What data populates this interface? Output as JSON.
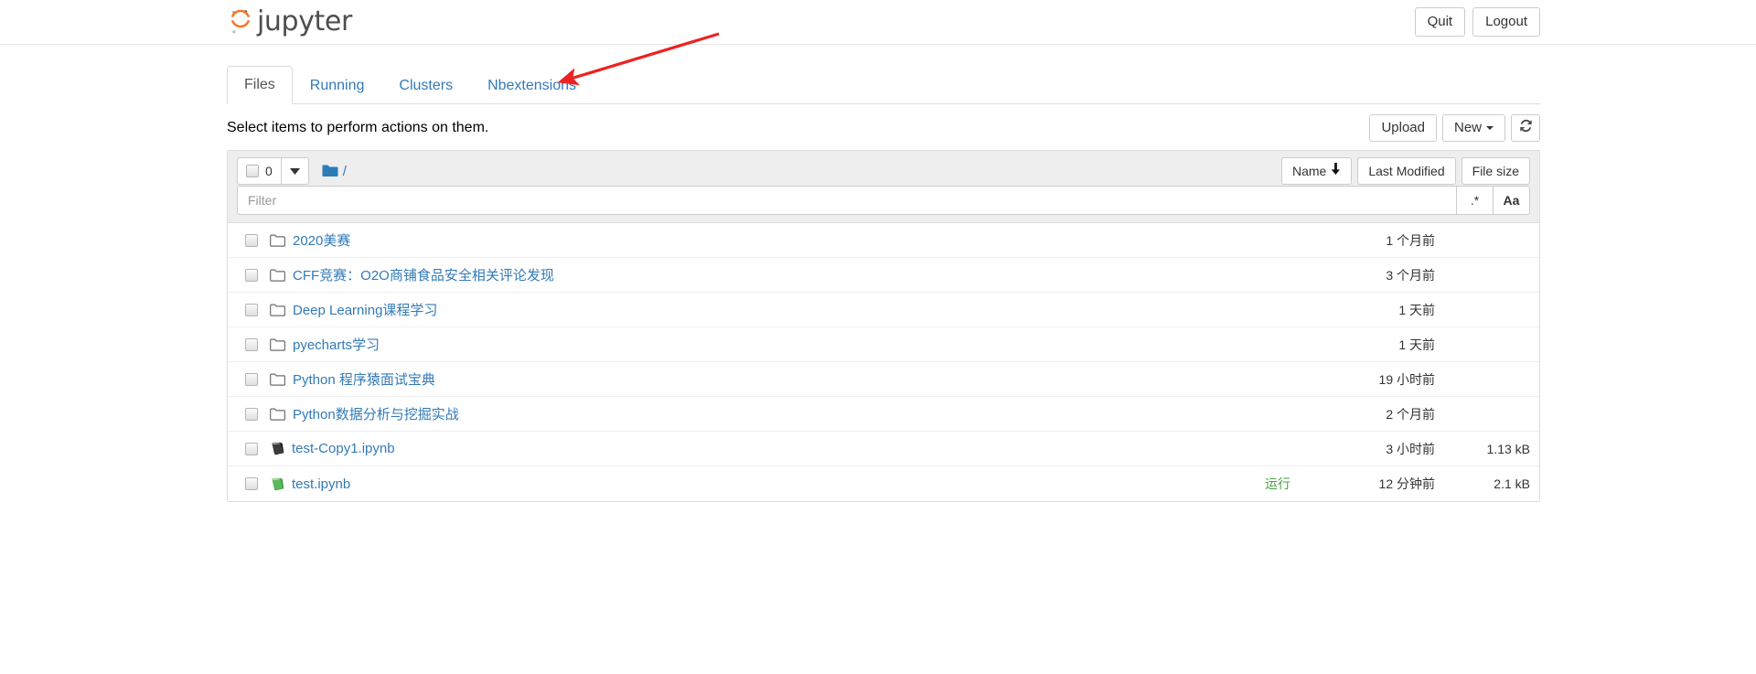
{
  "header": {
    "brand": "jupyter",
    "logo_icon": "jupyter-logo-icon",
    "quit_label": "Quit",
    "logout_label": "Logout"
  },
  "tabs": [
    {
      "label": "Files",
      "active": true
    },
    {
      "label": "Running",
      "active": false
    },
    {
      "label": "Clusters",
      "active": false
    },
    {
      "label": "Nbextensions",
      "active": false
    }
  ],
  "notice": "Select items to perform actions on them.",
  "top_actions": {
    "upload_label": "Upload",
    "new_label": "New",
    "refresh_icon": "refresh-icon"
  },
  "list_toolbar": {
    "selected_count": "0",
    "select_all_icon": "checkbox-icon",
    "dropdown_icon": "caret-down-icon",
    "breadcrumb_root_icon": "folder-filled-icon",
    "breadcrumb_root": "/",
    "sort": {
      "name_label": "Name",
      "name_sort_icon": "arrow-down-icon",
      "last_modified_label": "Last Modified",
      "file_size_label": "File size"
    }
  },
  "filter": {
    "value": "",
    "placeholder": "Filter",
    "regex_label": ".*",
    "case_label": "Aa"
  },
  "rows": [
    {
      "name": "2020美赛",
      "icon": "folder-icon",
      "time": "1 个月前",
      "size": "",
      "running": ""
    },
    {
      "name": "CFF竞赛：O2O商铺食品安全相关评论发现",
      "icon": "folder-icon",
      "time": "3 个月前",
      "size": "",
      "running": ""
    },
    {
      "name": "Deep Learning课程学习",
      "icon": "folder-icon",
      "time": "1 天前",
      "size": "",
      "running": ""
    },
    {
      "name": "pyecharts学习",
      "icon": "folder-icon",
      "time": "1 天前",
      "size": "",
      "running": ""
    },
    {
      "name": "Python 程序猿面试宝典",
      "icon": "folder-icon",
      "time": "19 小时前",
      "size": "",
      "running": ""
    },
    {
      "name": "Python数据分析与挖掘实战",
      "icon": "folder-icon",
      "time": "2 个月前",
      "size": "",
      "running": ""
    },
    {
      "name": "test-Copy1.ipynb",
      "icon": "notebook-icon",
      "time": "3 小时前",
      "size": "1.13 kB",
      "running": ""
    },
    {
      "name": "test.ipynb",
      "icon": "notebook-running-icon",
      "time": "12 分钟前",
      "size": "2.1 kB",
      "running": "运行"
    }
  ],
  "annotation": {
    "arrow_icon": "red-arrow-icon",
    "color": "#ee2222",
    "points_to": "Nbextensions"
  },
  "colors": {
    "link": "#337ab7",
    "brand_orange": "#f37726",
    "running_green": "#44a340",
    "toolbar_bg": "#eeeeee",
    "border": "#dddddd",
    "annotation_red": "#ee2222"
  }
}
